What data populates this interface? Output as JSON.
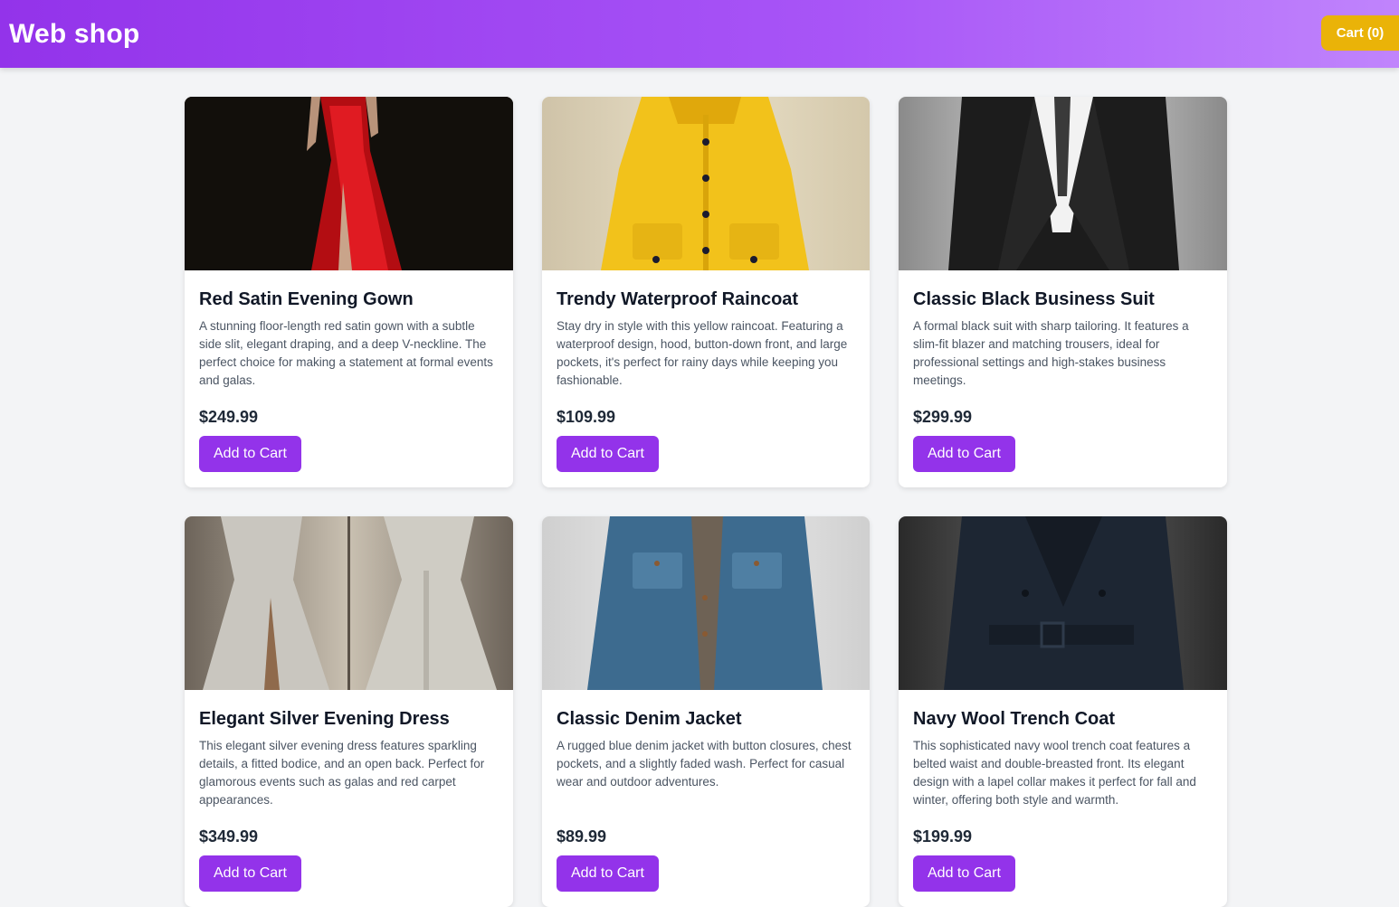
{
  "header": {
    "brand": "Web shop",
    "cart_label": "Cart (0)",
    "colors": {
      "gradient_start": "#9333ea",
      "gradient_end": "#c084fc",
      "cart": "#eab308"
    }
  },
  "products": [
    {
      "title": "Red Satin Evening Gown",
      "description": "A stunning floor-length red satin gown with a subtle side slit, elegant draping, and a deep V-neckline. The perfect choice for making a statement at formal events and galas.",
      "price": "$249.99",
      "button": "Add to Cart",
      "image_icon": "red-gown-image"
    },
    {
      "title": "Trendy Waterproof Raincoat",
      "description": "Stay dry in style with this yellow raincoat. Featuring a waterproof design, hood, button-down front, and large pockets, it's perfect for rainy days while keeping you fashionable.",
      "price": "$109.99",
      "button": "Add to Cart",
      "image_icon": "yellow-raincoat-image"
    },
    {
      "title": "Classic Black Business Suit",
      "description": "A formal black suit with sharp tailoring. It features a slim-fit blazer and matching trousers, ideal for professional settings and high-stakes business meetings.",
      "price": "$299.99",
      "button": "Add to Cart",
      "image_icon": "black-suit-image"
    },
    {
      "title": "Elegant Silver Evening Dress",
      "description": "This elegant silver evening dress features sparkling details, a fitted bodice, and an open back. Perfect for glamorous events such as galas and red carpet appearances.",
      "price": "$349.99",
      "button": "Add to Cart",
      "image_icon": "silver-dress-image"
    },
    {
      "title": "Classic Denim Jacket",
      "description": "A rugged blue denim jacket with button closures, chest pockets, and a slightly faded wash. Perfect for casual wear and outdoor adventures.",
      "price": "$89.99",
      "button": "Add to Cart",
      "image_icon": "denim-jacket-image"
    },
    {
      "title": "Navy Wool Trench Coat",
      "description": "This sophisticated navy wool trench coat features a belted waist and double-breasted front. Its elegant design with a lapel collar makes it perfect for fall and winter, offering both style and warmth.",
      "price": "$199.99",
      "button": "Add to Cart",
      "image_icon": "trench-coat-image"
    }
  ]
}
